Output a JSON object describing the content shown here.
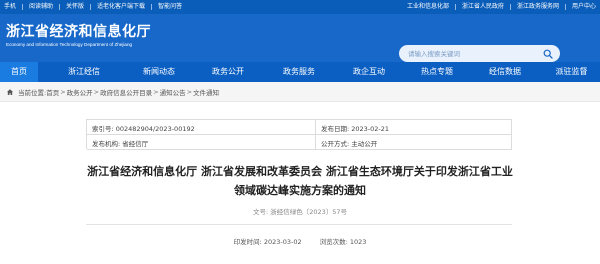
{
  "topbar": {
    "left_links": [
      "手机",
      "阅读辅助",
      "关怀版",
      "适老化客户端下载",
      "智能问答"
    ],
    "right_links": [
      "工业和信息化部",
      "浙江省人民政府",
      "浙江政务服务网",
      "用户中心"
    ]
  },
  "header": {
    "logo_cn": "浙江省经济和信息化厅",
    "logo_en": "Economy and Information Technology Department of Zhejiang",
    "search_placeholder": "请输入搜索关键词",
    "search_icon": "search-icon"
  },
  "nav": {
    "items": [
      "首页",
      "浙江经信",
      "新闻动态",
      "政务公开",
      "政务服务",
      "政企互动",
      "热点专题",
      "经信数据",
      "派驻监督"
    ],
    "active_index": 0
  },
  "breadcrumb": {
    "prefix": "当前位置:",
    "items": [
      "首页",
      "政务公开",
      "政府信息公开目录",
      "通知公告",
      "文件通知"
    ],
    "separator": ">"
  },
  "info_table": {
    "index_label": "索引号: 002482904/2023-00192",
    "publish_date_label": "发布日期: 2023-02-21",
    "issuer_label": "发布机构: 省经信厅",
    "public_type_label": "公开方式: 主动公开"
  },
  "article": {
    "title_line1": "浙江省经济和信息化厅 浙江省发展和改革委员会 浙江省生态环境厅关于印发浙江省工业",
    "title_line2": "领域碳达峰实施方案的通知",
    "doc_number": "文号: 浙经信绿色〔2023〕57号",
    "print_date": "印发时间: 2023-03-02",
    "views": "浏览次数: 1023"
  },
  "colors": {
    "topbar": "#0a5db9",
    "header": "#1768c9",
    "nav": "#0b5fc2",
    "nav_active": "#1a7be0"
  }
}
